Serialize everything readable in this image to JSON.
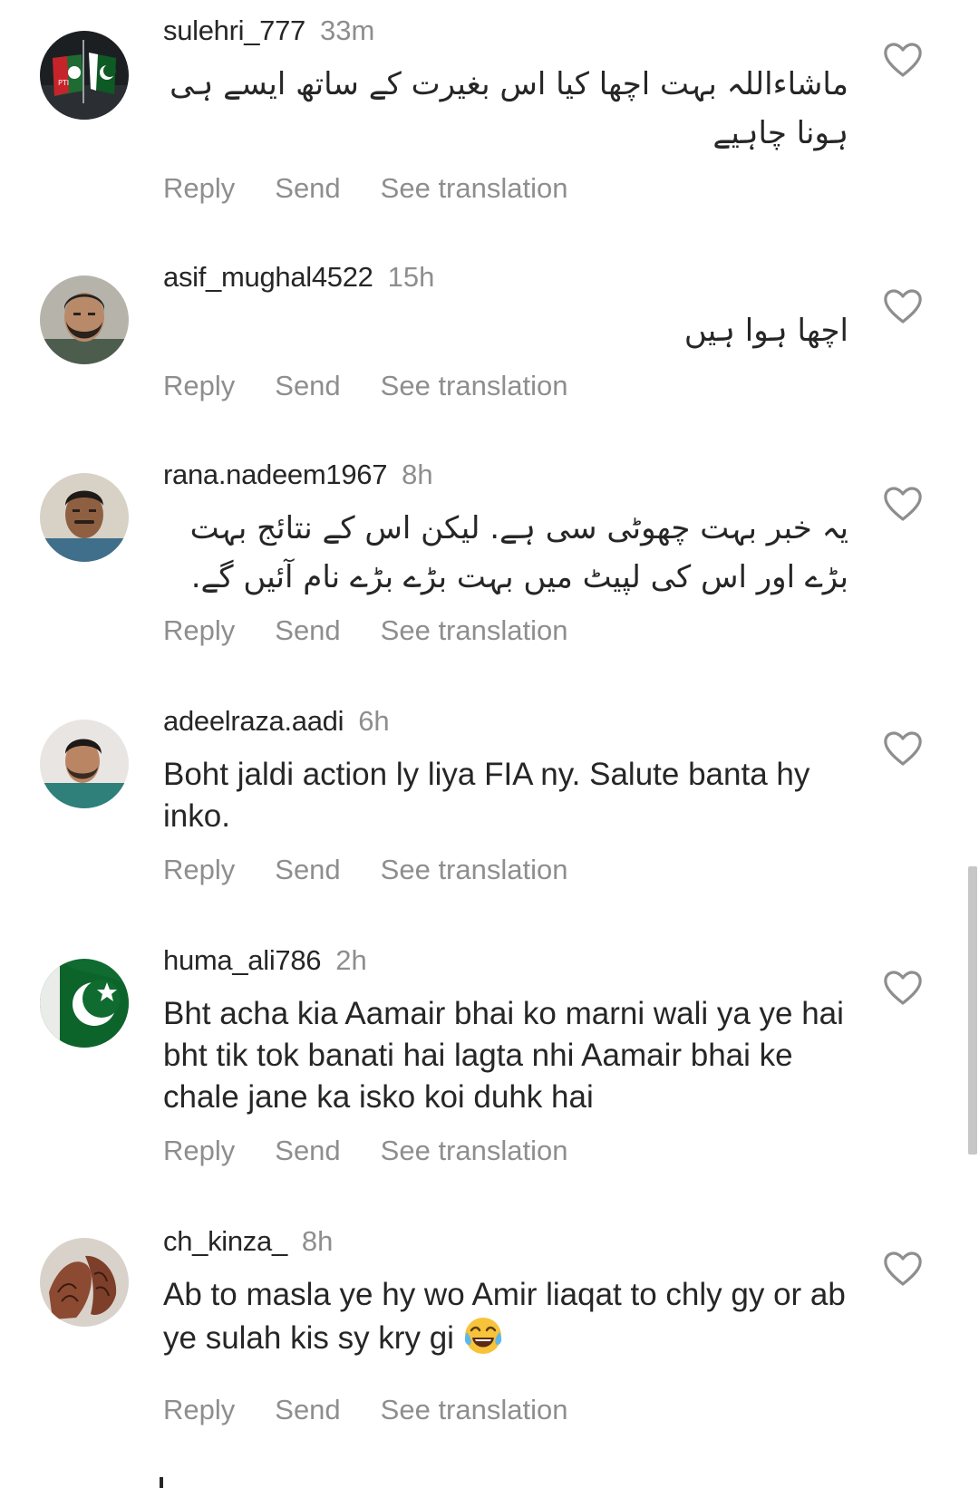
{
  "labels": {
    "reply": "Reply",
    "send": "Send",
    "see_translation": "See translation"
  },
  "comments": [
    {
      "username": "sulehri_777",
      "time": "33m",
      "text": "ماشاءاللہ بہت اچھا کیا اس بغیرت کے ساتھ ایسے ہی ہونا چاہیے",
      "avatar": "pti-flag-avatar"
    },
    {
      "username": "asif_mughal4522",
      "time": "15h",
      "text": "اچھا ہوا ہیں",
      "avatar": "bearded-man-avatar"
    },
    {
      "username": "rana.nadeem1967",
      "time": "8h",
      "text": "یہ خبر بہت چھوٹی سی ہے. لیکن اس کے نتائج بہت بڑے اور اس کی لپیٹ میں بہت بڑے بڑے نام آئیں گے.",
      "avatar": "older-man-avatar"
    },
    {
      "username": "adeelraza.aadi",
      "time": "6h",
      "text": "Boht jaldi action ly liya FIA ny. Salute banta hy inko.",
      "avatar": "young-man-avatar"
    },
    {
      "username": "huma_ali786",
      "time": "2h",
      "text": "Bht acha kia Aamair bhai ko marni wali ya ye hai bht tik tok banati hai lagta nhi Aamair bhai ke chale jane ka isko koi duhk hai",
      "avatar": "pakistan-flag-avatar"
    },
    {
      "username": "ch_kinza_",
      "time": "8h",
      "text": "Ab to masla ye hy wo Amir liaqat to chly gy or ab ye sulah kis sy kry gi",
      "avatar": "henna-hands-avatar",
      "emoji": "face-with-tears-of-joy-emoji"
    }
  ],
  "colors": {
    "text": "#262626",
    "secondary": "#8e8e8e",
    "background": "#ffffff"
  }
}
